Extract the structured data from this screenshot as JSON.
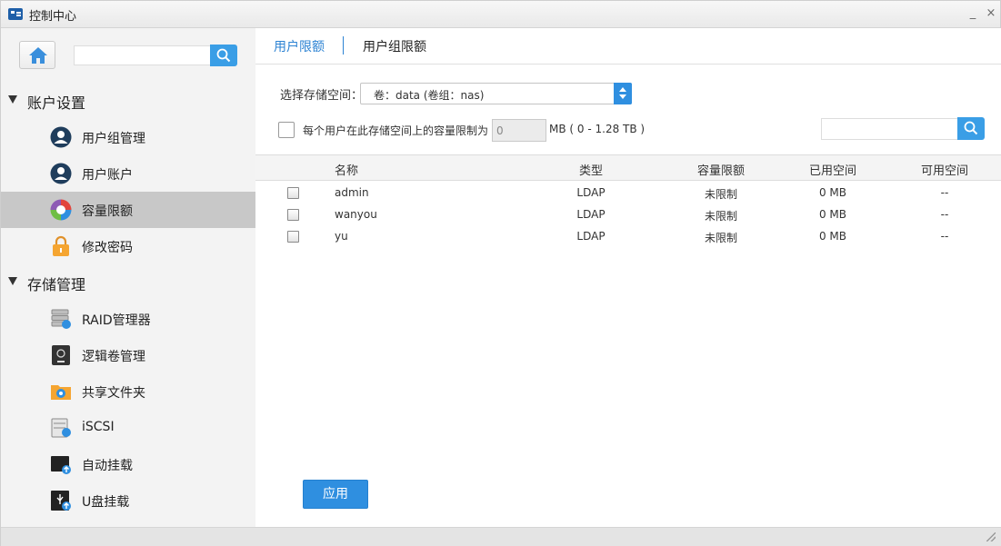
{
  "window": {
    "title": "控制中心",
    "minimize_label": "_",
    "close_label": "×"
  },
  "sidebar": {
    "search_placeholder": "",
    "sections": [
      {
        "label": "账户设置"
      },
      {
        "label": "存储管理"
      }
    ],
    "items": [
      {
        "label": "用户组管理",
        "icon": "user-group-icon"
      },
      {
        "label": "用户账户",
        "icon": "user-account-icon"
      },
      {
        "label": "容量限额",
        "icon": "quota-pie-icon",
        "active": true
      },
      {
        "label": "修改密码",
        "icon": "lock-icon"
      },
      {
        "label": "RAID管理器",
        "icon": "raid-icon"
      },
      {
        "label": "逻辑卷管理",
        "icon": "lvm-icon"
      },
      {
        "label": "共享文件夹",
        "icon": "shared-folder-icon"
      },
      {
        "label": "iSCSI",
        "icon": "iscsi-icon"
      },
      {
        "label": "自动挂载",
        "icon": "auto-mount-icon"
      },
      {
        "label": "U盘挂载",
        "icon": "usb-mount-icon"
      }
    ]
  },
  "tabs": [
    {
      "label": "用户限额",
      "active": true
    },
    {
      "label": "用户组限额",
      "active": false
    }
  ],
  "storage": {
    "label": "选择存储空间：",
    "selected": "卷：data (卷组：nas)"
  },
  "limit": {
    "checked": false,
    "text": "每个用户在此存储空间上的容量限制为",
    "value": "0",
    "unit": "MB ( 0 - 1.28 TB )"
  },
  "search": {
    "placeholder": ""
  },
  "table": {
    "columns": [
      "名称",
      "类型",
      "容量限额",
      "已用空间",
      "可用空间"
    ],
    "rows": [
      [
        "admin",
        "LDAP",
        "未限制",
        "0 MB",
        "--"
      ],
      [
        "wanyou",
        "LDAP",
        "未限制",
        "0 MB",
        "--"
      ],
      [
        "yu",
        "LDAP",
        "未限制",
        "0 MB",
        "--"
      ]
    ]
  },
  "apply_label": "应用",
  "colors": {
    "accent": "#2f8fe0",
    "active_item": "#c8c8c8",
    "tab_active": "#2d83d3"
  }
}
